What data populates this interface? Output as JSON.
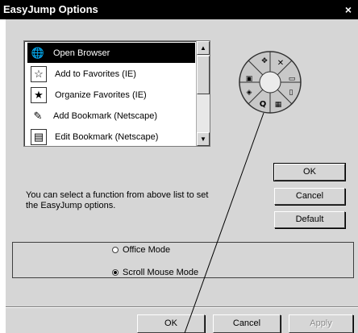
{
  "window": {
    "title": "EasyJump Options",
    "close_glyph": "×"
  },
  "function_list": {
    "items": [
      {
        "label": "Open Browser",
        "icon": "globe-icon",
        "glyph": "🌐",
        "selected": true
      },
      {
        "label": "Add to Favorites (IE)",
        "icon": "favorites-add-icon",
        "glyph": "☆",
        "selected": false
      },
      {
        "label": "Organize Favorites (IE)",
        "icon": "folder-star-icon",
        "glyph": "★",
        "selected": false
      },
      {
        "label": "Add Bookmark (Netscape)",
        "icon": "bookmark-add-icon",
        "glyph": "✎",
        "selected": false
      },
      {
        "label": "Edit Bookmark (Netscape)",
        "icon": "bookmark-edit-icon",
        "glyph": "▤",
        "selected": false
      }
    ],
    "scroll_up": "▲",
    "scroll_down": "▼"
  },
  "wheel": {
    "segments": [
      {
        "name": "move-icon",
        "glyph": "✥"
      },
      {
        "name": "close-icon",
        "glyph": "✕"
      },
      {
        "name": "minimize-icon",
        "glyph": "▭"
      },
      {
        "name": "page-icon",
        "glyph": "▯"
      },
      {
        "name": "grid-icon",
        "glyph": "▦"
      },
      {
        "name": "search-icon",
        "glyph": "Q"
      },
      {
        "name": "bookmark-icon",
        "glyph": "◈"
      },
      {
        "name": "window-icon",
        "glyph": "▣"
      }
    ]
  },
  "side_buttons": {
    "ok": "OK",
    "cancel": "Cancel",
    "default": "Default"
  },
  "info_text": "You can select a function from above list to set the EasyJump options.",
  "modes": {
    "office": {
      "label": "Office Mode",
      "selected": false
    },
    "scroll_mouse": {
      "label": "Scroll Mouse Mode",
      "selected": true
    }
  },
  "footer": {
    "ok": "OK",
    "cancel": "Cancel",
    "apply": "Apply"
  }
}
